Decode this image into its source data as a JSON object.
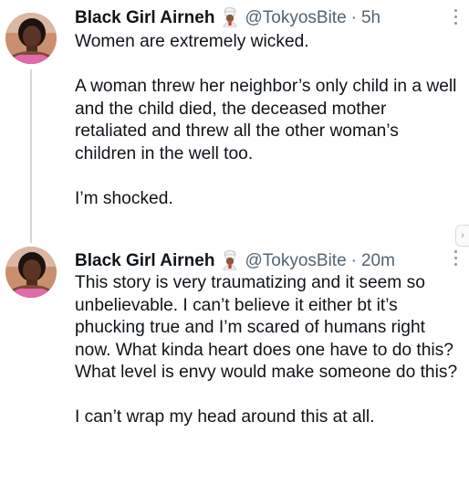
{
  "tweets": [
    {
      "name": "Black Girl Airneh",
      "emoji": "cook-emoji",
      "handle": "@TokyosBite",
      "separator": "·",
      "time": "5h",
      "paragraphs": [
        "Women are extremely wicked.",
        "A woman threw her neighbor’s only child in a well and the child died, the deceased mother retaliated and threw all the other woman’s children in the well too.",
        "I’m shocked."
      ]
    },
    {
      "name": "Black Girl Airneh",
      "emoji": "cook-emoji",
      "handle": "@TokyosBite",
      "separator": "·",
      "time": "20m",
      "paragraphs": [
        "This story is very traumatizing and it seem so unbelievable. I can’t believe  it either bt it’s phucking true and I’m scared of humans right now.  What kinda heart does one have to do this? What level is envy would make someone do this?",
        "I can’t wrap my head around this at all."
      ]
    }
  ],
  "edge_arrow_glyph": "›",
  "colors": {
    "text": "#0f1419",
    "secondary": "#536471",
    "thread_line": "#cfd9de"
  }
}
